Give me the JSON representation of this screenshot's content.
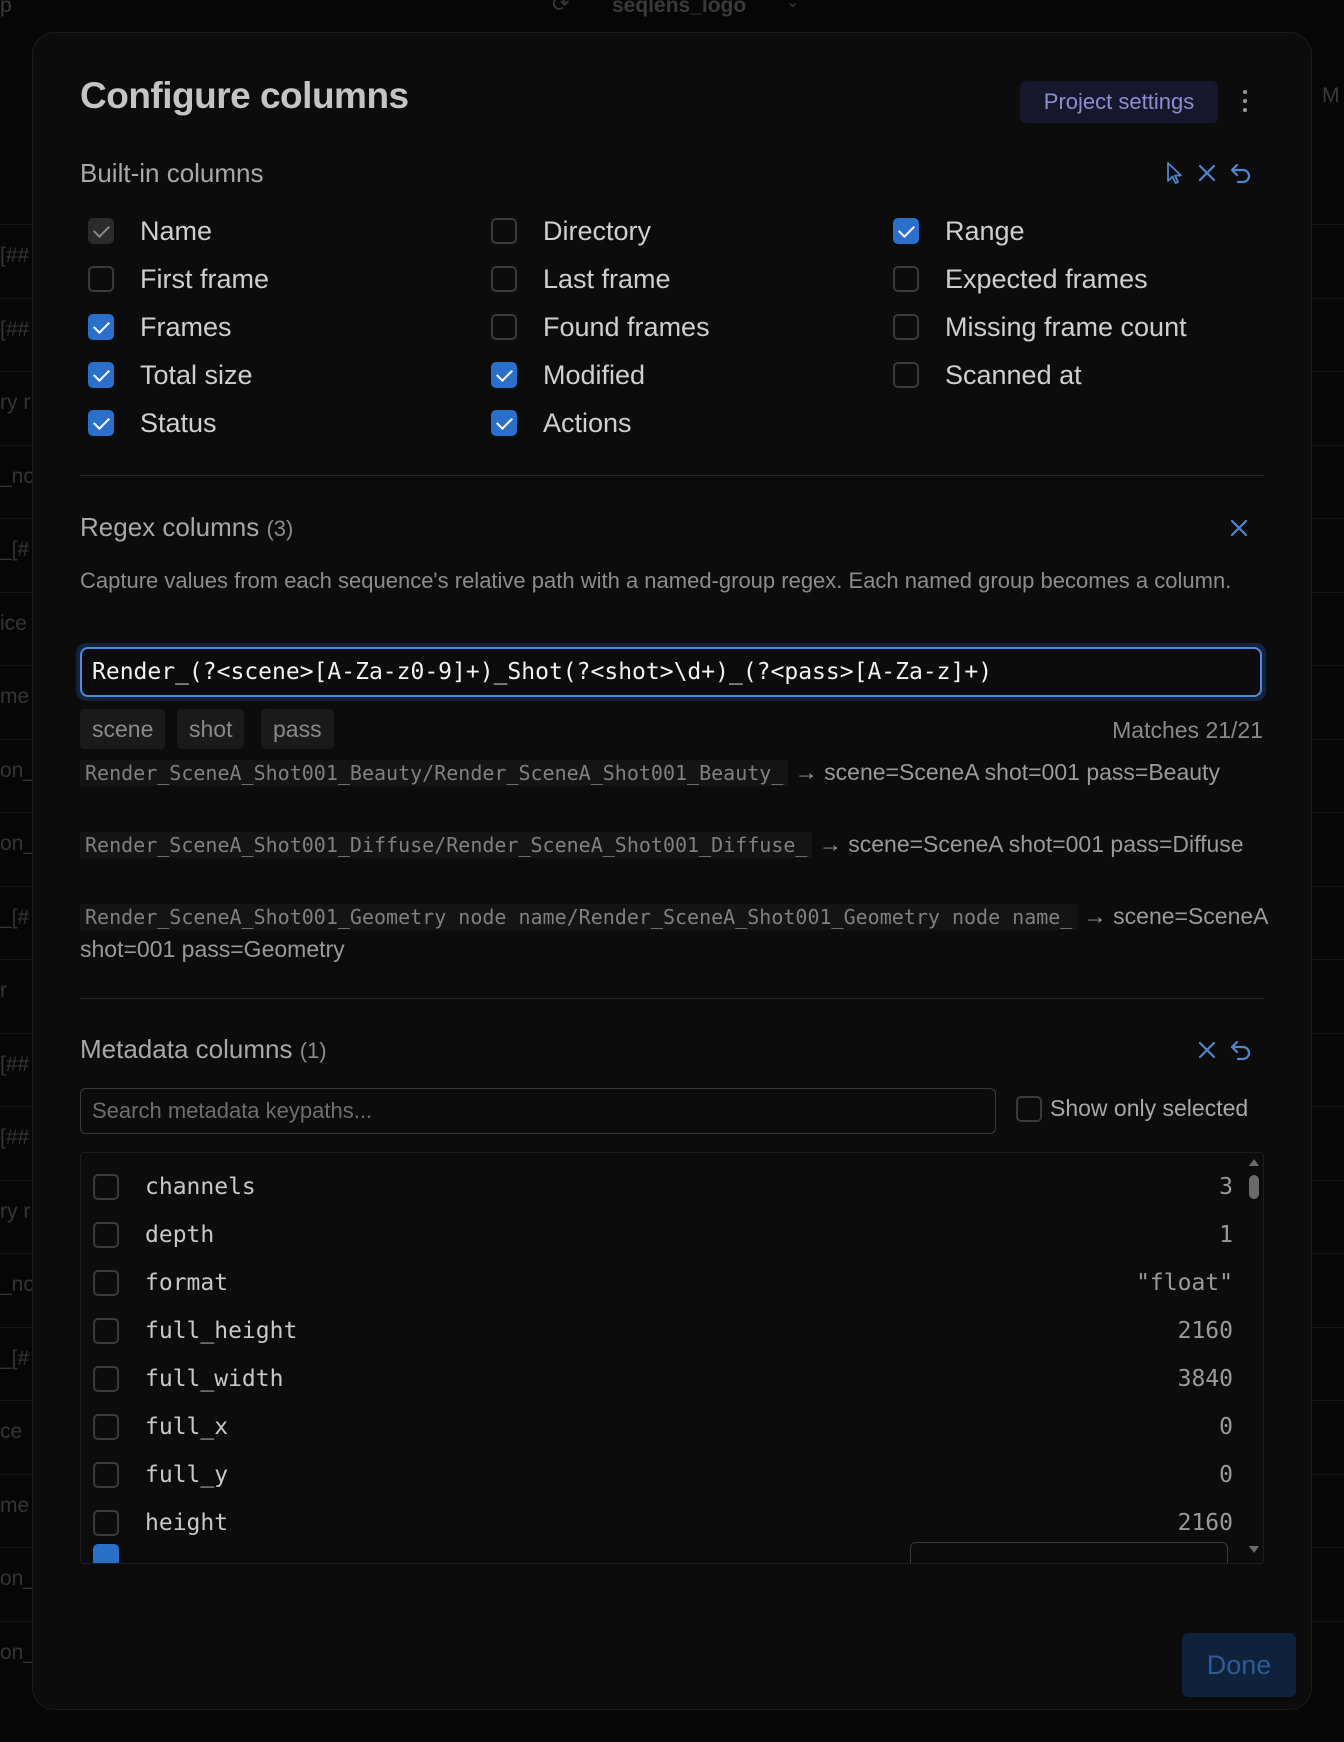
{
  "background": {
    "title": "seqlens_logo",
    "left_letter": "p",
    "right_letter": "M",
    "row_fragments": [
      "[##",
      "[##",
      "ry r",
      "_no",
      "_[#",
      "ice",
      "me",
      "on_",
      "on_",
      "_[#",
      "r",
      "[##",
      "[##",
      "ry r",
      "_no",
      "_[#",
      "ce",
      "me",
      "on_",
      "on_"
    ]
  },
  "modal": {
    "title": "Configure columns",
    "project_settings_label": "Project settings",
    "done_label": "Done"
  },
  "builtin": {
    "title": "Built-in columns",
    "items": [
      {
        "label": "Name",
        "state": "disabled"
      },
      {
        "label": "Directory",
        "state": "unchecked"
      },
      {
        "label": "Range",
        "state": "checked"
      },
      {
        "label": "First frame",
        "state": "unchecked"
      },
      {
        "label": "Last frame",
        "state": "unchecked"
      },
      {
        "label": "Expected frames",
        "state": "unchecked"
      },
      {
        "label": "Frames",
        "state": "checked"
      },
      {
        "label": "Found frames",
        "state": "unchecked"
      },
      {
        "label": "Missing frame count",
        "state": "unchecked"
      },
      {
        "label": "Total size",
        "state": "checked"
      },
      {
        "label": "Modified",
        "state": "checked"
      },
      {
        "label": "Scanned at",
        "state": "unchecked"
      },
      {
        "label": "Status",
        "state": "checked"
      },
      {
        "label": "Actions",
        "state": "checked"
      }
    ]
  },
  "regex": {
    "title": "Regex columns",
    "count": "(3)",
    "description": "Capture values from each sequence's relative path with a named-group regex. Each named group becomes a column.",
    "pattern": "Render_(?<scene>[A-Za-z0-9]+)_Shot(?<shot>\\d+)_(?<pass>[A-Za-z]+)",
    "groups": [
      "scene",
      "shot",
      "pass"
    ],
    "matches": "Matches 21/21",
    "examples": [
      {
        "path": "Render_SceneA_Shot001_Beauty/Render_SceneA_Shot001_Beauty_",
        "arrow": "→",
        "result": "scene=SceneA shot=001 pass=Beauty"
      },
      {
        "path": "Render_SceneA_Shot001_Diffuse/Render_SceneA_Shot001_Diffuse_",
        "arrow": "→",
        "result": "scene=SceneA shot=001 pass=Diffuse"
      },
      {
        "path": "Render_SceneA_Shot001_Geometry node name/Render_SceneA_Shot001_Geometry node name_",
        "arrow": "→",
        "result": "scene=SceneA shot=001 pass=Geometry"
      }
    ]
  },
  "metadata": {
    "title": "Metadata columns",
    "count": "(1)",
    "search_placeholder": "Search metadata keypaths...",
    "show_only_selected_label": "Show only selected",
    "rows": [
      {
        "key": "channels",
        "value": "3"
      },
      {
        "key": "depth",
        "value": "1"
      },
      {
        "key": "format",
        "value": "\"float\""
      },
      {
        "key": "full_height",
        "value": "2160"
      },
      {
        "key": "full_width",
        "value": "3840"
      },
      {
        "key": "full_x",
        "value": "0"
      },
      {
        "key": "full_y",
        "value": "0"
      },
      {
        "key": "height",
        "value": "2160"
      }
    ]
  },
  "icons": {
    "select_all": "cursor-pointer-icon",
    "clear": "close-icon",
    "reset": "undo-icon",
    "menu": "kebab-menu-icon"
  },
  "colors": {
    "accent": "#2a6fc9",
    "focus_ring": "#4f8be0",
    "project_button_bg": "#15172d",
    "project_button_text": "#8b8fd0"
  }
}
